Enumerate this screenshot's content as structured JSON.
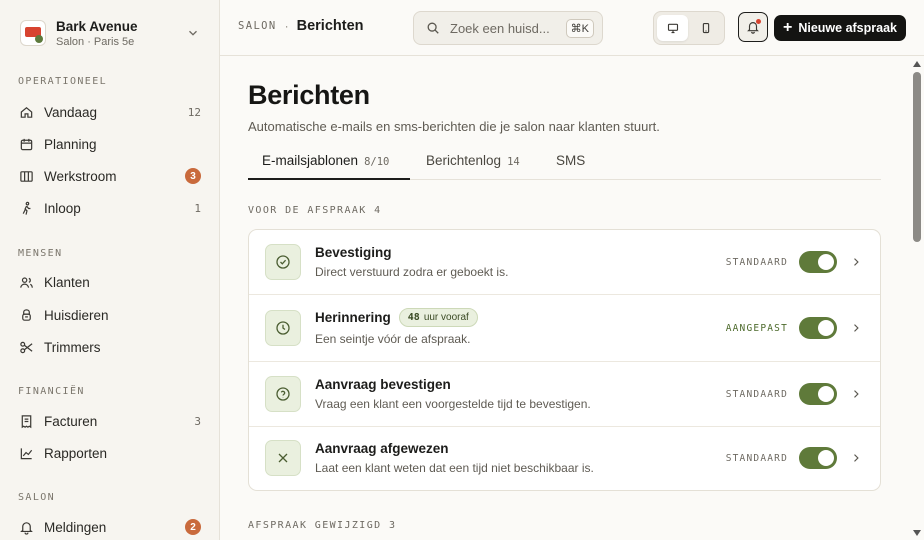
{
  "brand": {
    "name": "Bark Avenue",
    "subtitle": "Salon · Paris 5e"
  },
  "sidebar": {
    "sections": [
      {
        "label": "OPERATIONEEL"
      },
      {
        "label": "MENSEN"
      },
      {
        "label": "FINANCIËN"
      },
      {
        "label": "SALON"
      }
    ],
    "items": [
      {
        "label": "Vandaag",
        "count": "12",
        "icon": "home-icon"
      },
      {
        "label": "Planning",
        "icon": "calendar-icon"
      },
      {
        "label": "Werkstroom",
        "badge": "3",
        "icon": "columns-icon"
      },
      {
        "label": "Inloop",
        "count": "1",
        "icon": "walk-icon"
      },
      {
        "label": "Klanten",
        "icon": "users-icon"
      },
      {
        "label": "Huisdieren",
        "icon": "pet-icon"
      },
      {
        "label": "Trimmers",
        "icon": "scissors-icon"
      },
      {
        "label": "Facturen",
        "count": "3",
        "icon": "invoice-icon"
      },
      {
        "label": "Rapporten",
        "icon": "chart-line-icon"
      },
      {
        "label": "Meldingen",
        "badge": "2",
        "icon": "bell-icon"
      }
    ]
  },
  "topbar": {
    "crumb_root": "SALON",
    "crumb_sep": "·",
    "crumb_current": "Berichten",
    "search_placeholder": "Zoek een huisd...",
    "search_shortcut": "⌘K",
    "new_button": "Nieuwe afspraak"
  },
  "page": {
    "title": "Berichten",
    "subtitle": "Automatische e-mails en sms-berichten die je salon naar klanten stuurt.",
    "tabs": [
      {
        "label": "E-mailsjablonen",
        "count": "8/10"
      },
      {
        "label": "Berichtenlog",
        "count": "14"
      },
      {
        "label": "SMS",
        "count": ""
      }
    ],
    "group1": {
      "label": "VOOR DE AFSPRAAK",
      "count": "4"
    },
    "group2": {
      "label": "AFSPRAAK GEWIJZIGD",
      "count": "3"
    },
    "templates": [
      {
        "title": "Bevestiging",
        "desc": "Direct verstuurd zodra er geboekt is.",
        "status": "STANDAARD",
        "enabled": true,
        "icon": "check-circle-icon"
      },
      {
        "title": "Herinnering",
        "pill_value": "48",
        "pill_text": "uur vooraf",
        "desc": "Een seintje vóór de afspraak.",
        "status": "AANGEPAST",
        "enabled": true,
        "icon": "clock-icon"
      },
      {
        "title": "Aanvraag bevestigen",
        "desc": "Vraag een klant een voorgestelde tijd te bevestigen.",
        "status": "STANDAARD",
        "enabled": true,
        "icon": "question-circle-icon"
      },
      {
        "title": "Aanvraag afgewezen",
        "desc": "Laat een klant weten dat een tijd niet beschikbaar is.",
        "status": "STANDAARD",
        "enabled": true,
        "icon": "x-icon"
      }
    ]
  },
  "colors": {
    "accent_green": "#5f7a3a",
    "badge_orange": "#c96a3c",
    "primary_button": "#141412"
  }
}
